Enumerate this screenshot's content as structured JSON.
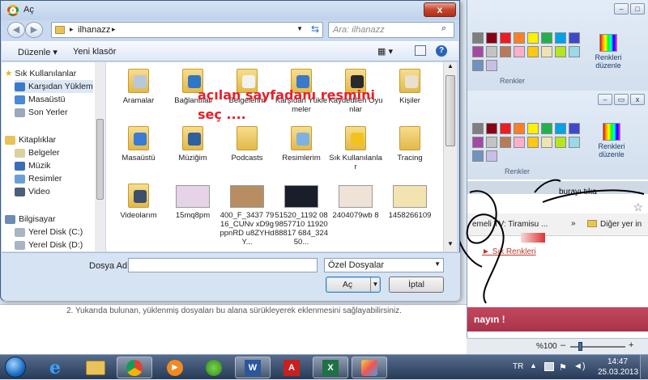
{
  "dialog": {
    "title": "Aç",
    "close_glyph": "x",
    "breadcrumb": [
      "ilhanazz"
    ],
    "search_placeholder": "Ara: ilhanazz",
    "toolbar": {
      "organize": "Düzenle",
      "new_folder": "Yeni klasör"
    },
    "nav": {
      "favorites_header": "Sık Kullanılanlar",
      "favorites": [
        "Karşıdan Yüklem",
        "Masaüstü",
        "Son Yerler"
      ],
      "libraries_header": "Kitaplıklar",
      "libraries": [
        "Belgeler",
        "Müzik",
        "Resimler",
        "Video"
      ],
      "computer_header": "Bilgisayar",
      "drives": [
        "Yerel Disk (C:)",
        "Yerel Disk (D:)"
      ]
    },
    "files": [
      {
        "name": "Aramalar",
        "kind": "search-folder"
      },
      {
        "name": "Bağlantılar",
        "kind": "links-folder"
      },
      {
        "name": "Belgelerim",
        "kind": "documents-folder"
      },
      {
        "name": "Karşıdan Yüklemeler",
        "kind": "downloads-folder"
      },
      {
        "name": "Kaydedilen Oyunlar",
        "kind": "games-folder"
      },
      {
        "name": "Kişiler",
        "kind": "contacts-folder"
      },
      {
        "name": "Masaüstü",
        "kind": "desktop-folder"
      },
      {
        "name": "Müziğim",
        "kind": "music-folder"
      },
      {
        "name": "Podcasts",
        "kind": "folder"
      },
      {
        "name": "Resimlerim",
        "kind": "pictures-folder"
      },
      {
        "name": "Sık Kullanılanlar",
        "kind": "favorites-folder"
      },
      {
        "name": "Tracing",
        "kind": "folder"
      },
      {
        "name": "Videolarım",
        "kind": "videos-folder"
      },
      {
        "name": "15mq8pm",
        "kind": "image"
      },
      {
        "name": "400_F_3437 7916_CUNv xD9gppnRD u8ZYHdY...",
        "kind": "image"
      },
      {
        "name": "51520_1192 089857710 1192088817 684_32450...",
        "kind": "image"
      },
      {
        "name": "2404079wb 8",
        "kind": "image"
      },
      {
        "name": "1458266109",
        "kind": "image"
      }
    ],
    "filename_label": "Dosya Adı:",
    "filename_value": "",
    "filetype_value": "Özel Dosyalar",
    "open_button": "Aç",
    "cancel_button": "İptal"
  },
  "annotation": {
    "line1": "açılan sayfadanı resmini",
    "line2": "seç ....",
    "note": "burayı tıka"
  },
  "paint": {
    "edit_colors_line1": "Renkleri",
    "edit_colors_line2": "düzenle",
    "colors_group": "Renkler",
    "palette": [
      "#7f7f7f",
      "#880015",
      "#ed1c24",
      "#ff7f27",
      "#fff200",
      "#22b14c",
      "#00a2e8",
      "#3f48cc",
      "#a349a4",
      "#c3c3c3",
      "#b97a57",
      "#ffaec9",
      "#ffc90e",
      "#efe4b0",
      "#b5e61d",
      "#99d9ea",
      "#7092be",
      "#c8bfe7"
    ]
  },
  "browser": {
    "bookmark": "emeli TV: Tiramisu ...",
    "more": "»",
    "other_bookmarks": "Diğer yer in",
    "link_text": "Sık Renkleri",
    "banner_text": "nayın !"
  },
  "page": {
    "instruction": "2. Yukarıda bulunan, yüklenmiş dosyaları bu alana sürükleyerek eklenmesini sağlayabilirsiniz."
  },
  "statusbar": {
    "zoom": "%100"
  },
  "taskbar": {
    "language": "TR",
    "time": "14:47",
    "date": "25.03.2013",
    "apps": [
      "start-orb",
      "internet-explorer",
      "file-explorer",
      "chrome",
      "media-player",
      "messenger",
      "word",
      "acrobat",
      "excel",
      "paint"
    ]
  }
}
